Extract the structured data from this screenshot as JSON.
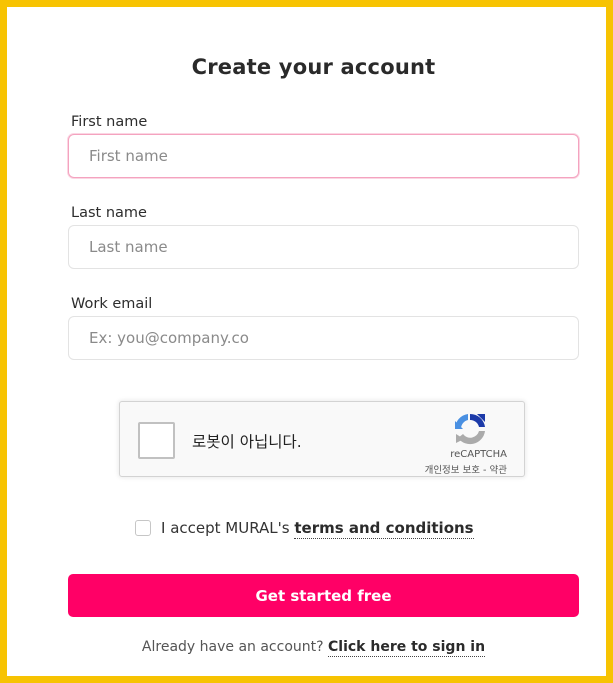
{
  "form": {
    "title": "Create your account",
    "first_name": {
      "label": "First name",
      "placeholder": "First name",
      "value": ""
    },
    "last_name": {
      "label": "Last name",
      "placeholder": "Last name",
      "value": ""
    },
    "work_email": {
      "label": "Work email",
      "placeholder": "Ex: you@company.co",
      "value": ""
    }
  },
  "recaptcha": {
    "label": "로봇이 아닙니다.",
    "brand": "reCAPTCHA",
    "links": "개인정보 보호 - 약관",
    "icon": "recaptcha-logo-icon"
  },
  "terms": {
    "prefix": "I accept MURAL's ",
    "link_text": "terms and conditions",
    "checked": false
  },
  "cta": {
    "label": "Get started free"
  },
  "signin": {
    "prompt": "Already have an account? ",
    "link_text": "Click here to sign in"
  },
  "colors": {
    "frame": "#f7c302",
    "primary": "#ff0066",
    "focus_border": "#f4a3bf"
  }
}
